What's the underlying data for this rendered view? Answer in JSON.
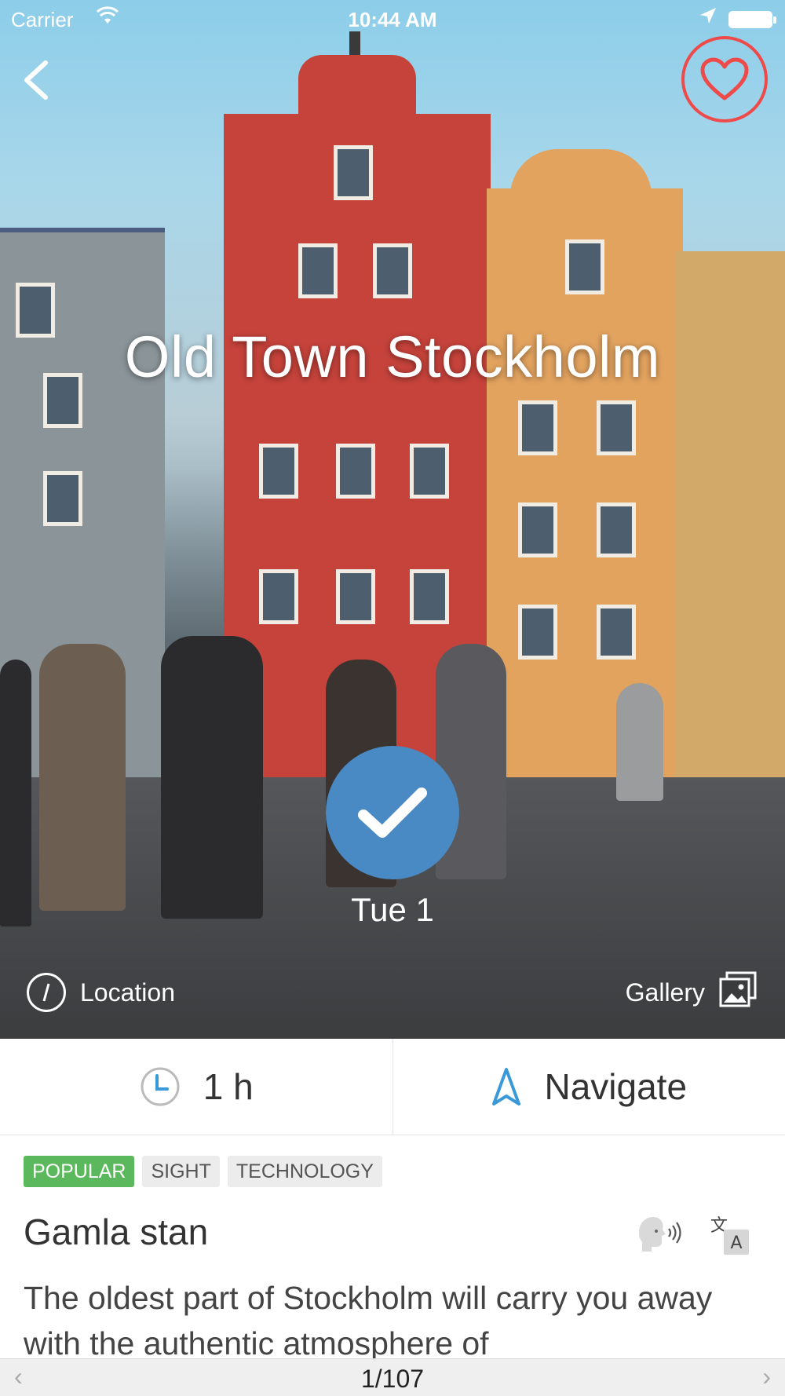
{
  "status_bar": {
    "carrier": "Carrier",
    "time": "10:44 AM"
  },
  "hero": {
    "title": "Old Town Stockholm",
    "day_label": "Tue 1",
    "location_label": "Location",
    "gallery_label": "Gallery"
  },
  "actions": {
    "duration": "1 h",
    "navigate": "Navigate"
  },
  "tags": [
    "POPULAR",
    "SIGHT",
    "TECHNOLOGY"
  ],
  "content": {
    "subtitle": "Gamla stan",
    "description": "The oldest part of Stockholm will carry you away with the authentic atmosphere of"
  },
  "pager": {
    "label": "1/107",
    "prev": "‹",
    "next": "›"
  },
  "colors": {
    "accent_blue": "#4a8ac4",
    "favorite_red": "#ef4a4a",
    "popular_green": "#5cb85c",
    "navigate_blue": "#3a9ad9"
  },
  "icons": {
    "back": "chevron-left-icon",
    "favorite": "heart-icon",
    "check": "check-icon",
    "location": "compass-icon",
    "gallery": "gallery-icon",
    "duration": "clock-icon",
    "navigate": "navigation-arrow-icon",
    "speak": "speaker-head-icon",
    "translate": "translate-icon"
  }
}
